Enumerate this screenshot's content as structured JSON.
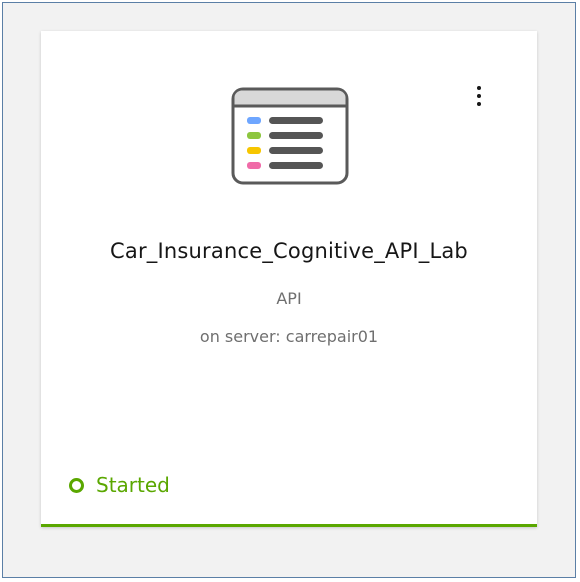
{
  "card": {
    "title": "Car_Insurance_Cognitive_API_Lab",
    "type": "API",
    "server": "on server: carrepair01",
    "status": "Started",
    "icon": "api-list-icon",
    "menu_icon": "overflow-menu-icon"
  },
  "colors": {
    "status_green": "#5aa700",
    "text_primary": "#161616",
    "text_secondary": "#6f6f6f",
    "icon_blue": "#6ea6ff",
    "icon_green": "#8dc63f",
    "icon_yellow": "#f7c600",
    "icon_pink": "#f06ba8"
  }
}
